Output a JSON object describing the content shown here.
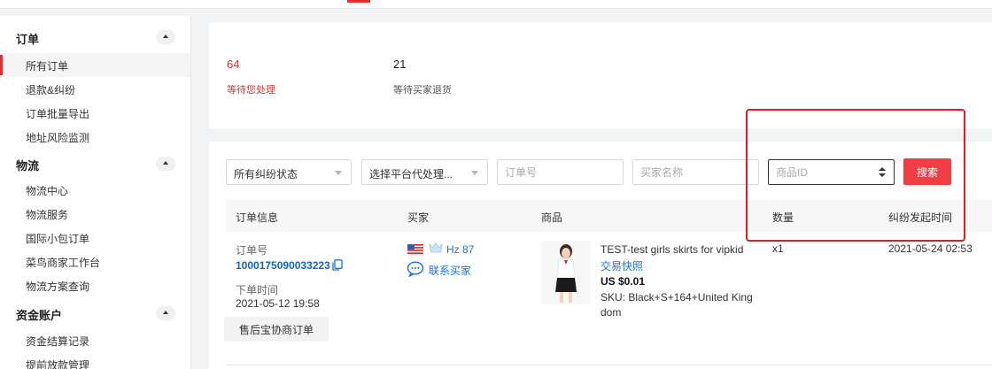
{
  "sidebar": {
    "sections": [
      {
        "title": "订单",
        "items": [
          "所有订单",
          "退款&纠纷",
          "订单批量导出",
          "地址风险监测"
        ]
      },
      {
        "title": "物流",
        "items": [
          "物流中心",
          "物流服务",
          "国际小包订单",
          "菜鸟商家工作台",
          "物流方案查询"
        ]
      },
      {
        "title": "资金账户",
        "items": [
          "资金结算记录",
          "提前放款管理"
        ]
      }
    ],
    "active_item": "所有订单"
  },
  "stats": [
    {
      "count": "64",
      "label": "等待您处理",
      "color": "#e62e2e"
    },
    {
      "count": "21",
      "label": "等待买家退货",
      "color": "#333333"
    }
  ],
  "filters": {
    "dispute_status": "所有纠纷状态",
    "platform_agent": "选择平台代处理...",
    "order_no_placeholder": "订单号",
    "buyer_name_placeholder": "买家名称",
    "product_id_placeholder": "商品ID",
    "search_label": "搜索"
  },
  "table": {
    "headers": [
      "订单信息",
      "买家",
      "商品",
      "数量",
      "纠纷发起时间"
    ],
    "row": {
      "order_no_label": "订单号",
      "order_no": "1000175090033223",
      "order_time_label": "下单时间",
      "order_time": "2021-05-12 19:58",
      "after_sale_label": "售后宝协商订单",
      "buyer_name": "Hz 87",
      "contact_buyer": "联系买家",
      "product_title": "TEST-test girls skirts for vipkid",
      "snapshot": "交易快照",
      "price": "US $0.01",
      "sku_line1": "SKU: Black+S+164+United King",
      "sku_line2": "dom",
      "quantity": "x1",
      "dispute_time": "2021-05-24 02:53"
    }
  },
  "colors": {
    "accent_red": "#e62e2e",
    "search_button": "#ef3f44",
    "link_blue": "#1a73e8",
    "highlight_border": "#e11c24"
  },
  "icons": [
    "chevron-up-icon",
    "copy-icon",
    "us-flag-icon",
    "crown-icon",
    "chat-icon"
  ]
}
